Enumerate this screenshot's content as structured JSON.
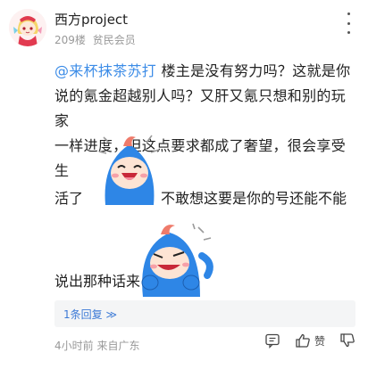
{
  "comment": {
    "username": "西方project",
    "floor": "209楼",
    "member_level": "贫民会员",
    "mention": "@来杯抹茶苏打",
    "text_line1": "楼主是没有努力吗？这就是你",
    "text_line2": "说的氪金超越别人吗？又肝又氪只想和别的玩家",
    "text_line3": "一样进度，但这点要求都成了奢望，很会享受生",
    "text_before_sticker1": "活了",
    "text_after_sticker1": "不敢想这要是你的号还能不能",
    "text_before_sticker2": "说出那种话来",
    "reply_count_label": "1条回复",
    "reply_chevron": "≫",
    "time": "4小时前",
    "location": "来自广东",
    "like_label": "赞"
  },
  "icons": {
    "more": "more-dots-icon",
    "comment": "comment-icon",
    "like": "thumb-up-icon",
    "dislike": "thumb-down-icon"
  },
  "colors": {
    "mention": "#3c8ce7",
    "reply_link": "#3c7ad6",
    "meta": "#999999"
  }
}
